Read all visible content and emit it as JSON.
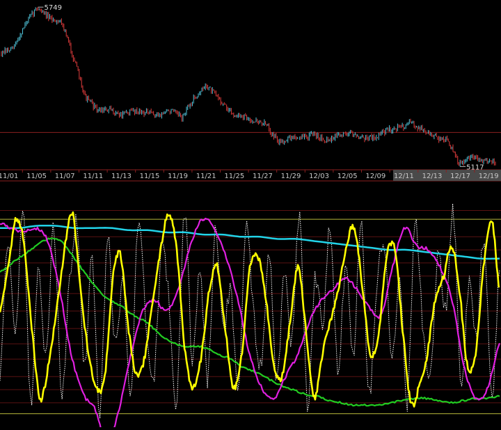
{
  "chart_data": [
    {
      "type": "line",
      "name": "price-panel",
      "x_labels": [
        "11/01",
        "11/05",
        "11/07",
        "11/11",
        "11/13",
        "11/15",
        "11/19",
        "11/21",
        "11/25",
        "11/27",
        "11/29",
        "12/03",
        "12/05",
        "12/09",
        "12/11",
        "12/13",
        "12/17",
        "12/19"
      ],
      "price_path": [
        5560,
        5580,
        5680,
        5749,
        5700,
        5690,
        5540,
        5380,
        5330,
        5330,
        5310,
        5330,
        5320,
        5310,
        5330,
        5300,
        5380,
        5430,
        5380,
        5320,
        5300,
        5290,
        5270,
        5200,
        5220,
        5220,
        5230,
        5210,
        5230,
        5240,
        5220,
        5220,
        5250,
        5260,
        5280,
        5250,
        5220,
        5210,
        5110,
        5140,
        5130,
        5120
      ],
      "high_label": "5749",
      "low_label": "5117",
      "reference_level": 5240,
      "ylim": [
        5100,
        5760
      ],
      "colors": {
        "up": "#4fc3d9",
        "down": "#e03c3c",
        "reference": "#8b1f1f",
        "axis_text": "#c8c8c8"
      }
    },
    {
      "type": "line",
      "name": "oscillator-panel",
      "ylim": [
        0,
        100
      ],
      "reference_levels": [
        96,
        84,
        78,
        72,
        66,
        58,
        50,
        42,
        35,
        28,
        20,
        14,
        8
      ],
      "band_levels": [
        92,
        3
      ],
      "series": [
        {
          "key": "cyan",
          "color": "#22d3e8",
          "values": [
            88,
            88,
            89,
            89,
            88,
            88,
            88,
            87,
            87,
            86,
            86,
            85,
            85,
            84,
            84,
            83,
            83,
            82,
            81,
            80,
            79,
            78,
            78,
            77,
            76,
            75,
            74,
            74
          ]
        },
        {
          "key": "green",
          "color": "#22cc22",
          "values": [
            68,
            72,
            76,
            80,
            83,
            82,
            75,
            67,
            60,
            55,
            52,
            48,
            45,
            40,
            36,
            34,
            34,
            33,
            30,
            28,
            24,
            22,
            19,
            16,
            14,
            12,
            11,
            9,
            8,
            7,
            7,
            7,
            8,
            9,
            10,
            10,
            9,
            8,
            9,
            10,
            10,
            11
          ]
        },
        {
          "key": "magenta",
          "color": "#e020e0",
          "values": [
            90,
            88,
            86,
            88,
            82,
            60,
            30,
            12,
            5,
            -10,
            5,
            30,
            50,
            55,
            50,
            60,
            80,
            92,
            88,
            75,
            55,
            30,
            15,
            10,
            20,
            30,
            45,
            55,
            60,
            65,
            60,
            52,
            48,
            70,
            88,
            80,
            78,
            70,
            55,
            25,
            10,
            15,
            35
          ]
        },
        {
          "key": "yellow",
          "color": "#ffff00",
          "values": [
            50,
            70,
            92,
            80,
            40,
            10,
            25,
            50,
            78,
            95,
            60,
            30,
            15,
            20,
            65,
            75,
            40,
            20,
            30,
            55,
            80,
            95,
            75,
            30,
            15,
            30,
            60,
            70,
            40,
            15,
            30,
            70,
            75,
            55,
            25,
            20,
            45,
            70,
            40,
            10,
            30,
            45,
            60,
            80,
            88,
            60,
            30,
            40,
            75,
            78,
            40,
            8,
            15,
            30,
            55,
            65,
            80,
            60,
            25,
            30,
            70,
            92,
            60
          ]
        },
        {
          "key": "dotted",
          "color": "#ffffff",
          "values": [
            20,
            80,
            40,
            95,
            10,
            70,
            30,
            88,
            15,
            60,
            90,
            25,
            75,
            5,
            85,
            35,
            65,
            12,
            92,
            45,
            20,
            78,
            55,
            8,
            95,
            30,
            70,
            18,
            85,
            40,
            60,
            10,
            90,
            50,
            25,
            80,
            15,
            70,
            35,
            95,
            5,
            65,
            45,
            88,
            20,
            75,
            30,
            92,
            12,
            58,
            82,
            28,
            68,
            8,
            90,
            42,
            22,
            76,
            50,
            95,
            15,
            62,
            38,
            85,
            10,
            70
          ]
        }
      ]
    }
  ]
}
